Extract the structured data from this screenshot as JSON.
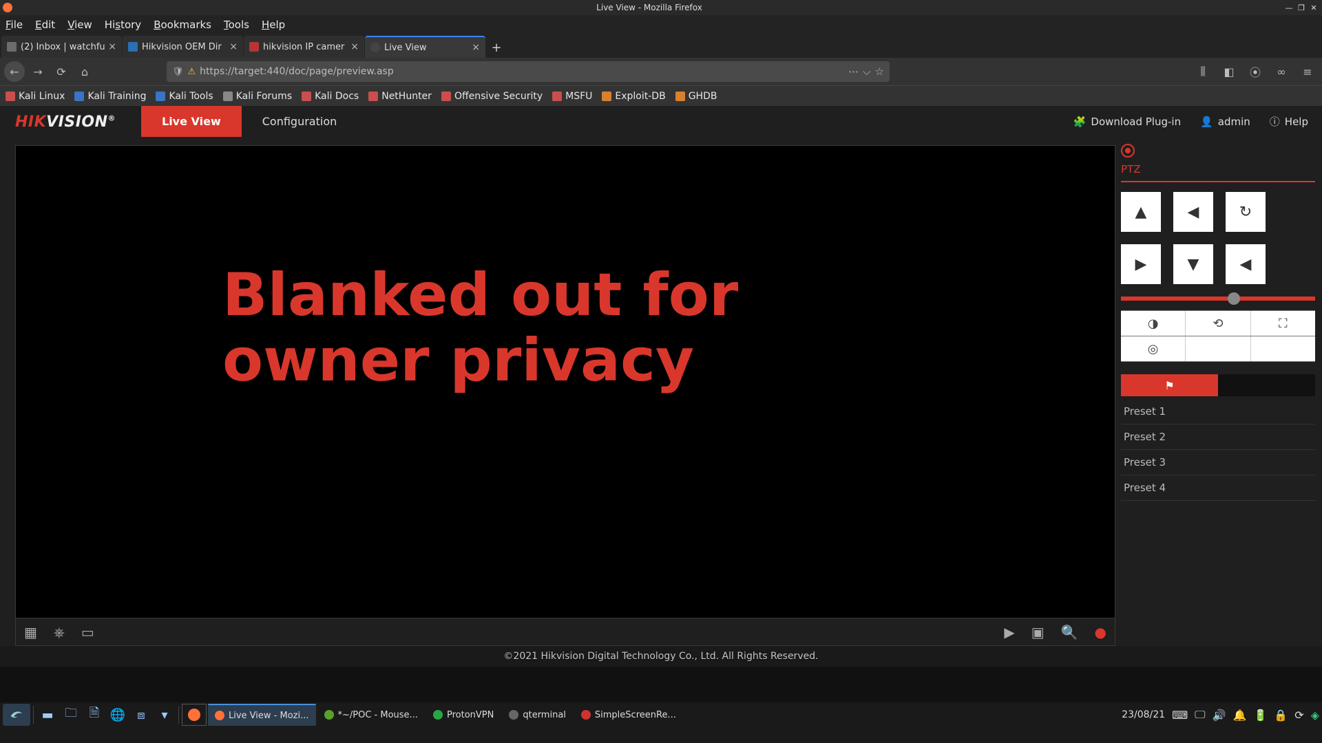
{
  "window": {
    "title": "Live View - Mozilla Firefox",
    "min": "—",
    "restore": "❐",
    "close": "✕"
  },
  "menubar": {
    "file": "File",
    "edit": "Edit",
    "view": "View",
    "history": "History",
    "bookmarks": "Bookmarks",
    "tools": "Tools",
    "help": "Help"
  },
  "tabs": [
    {
      "label": "(2) Inbox | watchfu"
    },
    {
      "label": "Hikvision OEM Dir"
    },
    {
      "label": "hikvision IP camer"
    },
    {
      "label": "Live View"
    }
  ],
  "url": "https://target:440/doc/page/preview.asp",
  "bookmarks": [
    {
      "label": "Kali Linux"
    },
    {
      "label": "Kali Training"
    },
    {
      "label": "Kali Tools"
    },
    {
      "label": "Kali Forums"
    },
    {
      "label": "Kali Docs"
    },
    {
      "label": "NetHunter"
    },
    {
      "label": "Offensive Security"
    },
    {
      "label": "MSFU"
    },
    {
      "label": "Exploit-DB"
    },
    {
      "label": "GHDB"
    }
  ],
  "hk": {
    "logo_red": "HIK",
    "logo_white": "VISION",
    "logo_sup": "®",
    "live_view": "Live View",
    "configuration": "Configuration",
    "plugin": "Download Plug-in",
    "user": "admin",
    "help": "Help",
    "overlay_line1": "Blanked out for",
    "overlay_line2": "owner privacy",
    "ptz_label": "PTZ",
    "presets": [
      "Preset 1",
      "Preset 2",
      "Preset 3",
      "Preset 4"
    ],
    "copyright": "©2021 Hikvision Digital Technology Co., Ltd. All Rights Reserved."
  },
  "ptz_grid": [
    "▲",
    "◀",
    "↻",
    "▶",
    "▼",
    "◀"
  ],
  "taskbar": {
    "apps": [
      {
        "label": "Live View - Mozi...",
        "icon_color": "#ff7139"
      },
      {
        "label": "*~/POC - Mouse...",
        "icon_color": "#5aa02c"
      },
      {
        "label": "ProtonVPN",
        "icon_color": "#28a745"
      },
      {
        "label": "qterminal",
        "icon_color": "#777"
      },
      {
        "label": "SimpleScreenRe...",
        "icon_color": "#d0332f"
      }
    ],
    "clock": "23/08/21"
  }
}
